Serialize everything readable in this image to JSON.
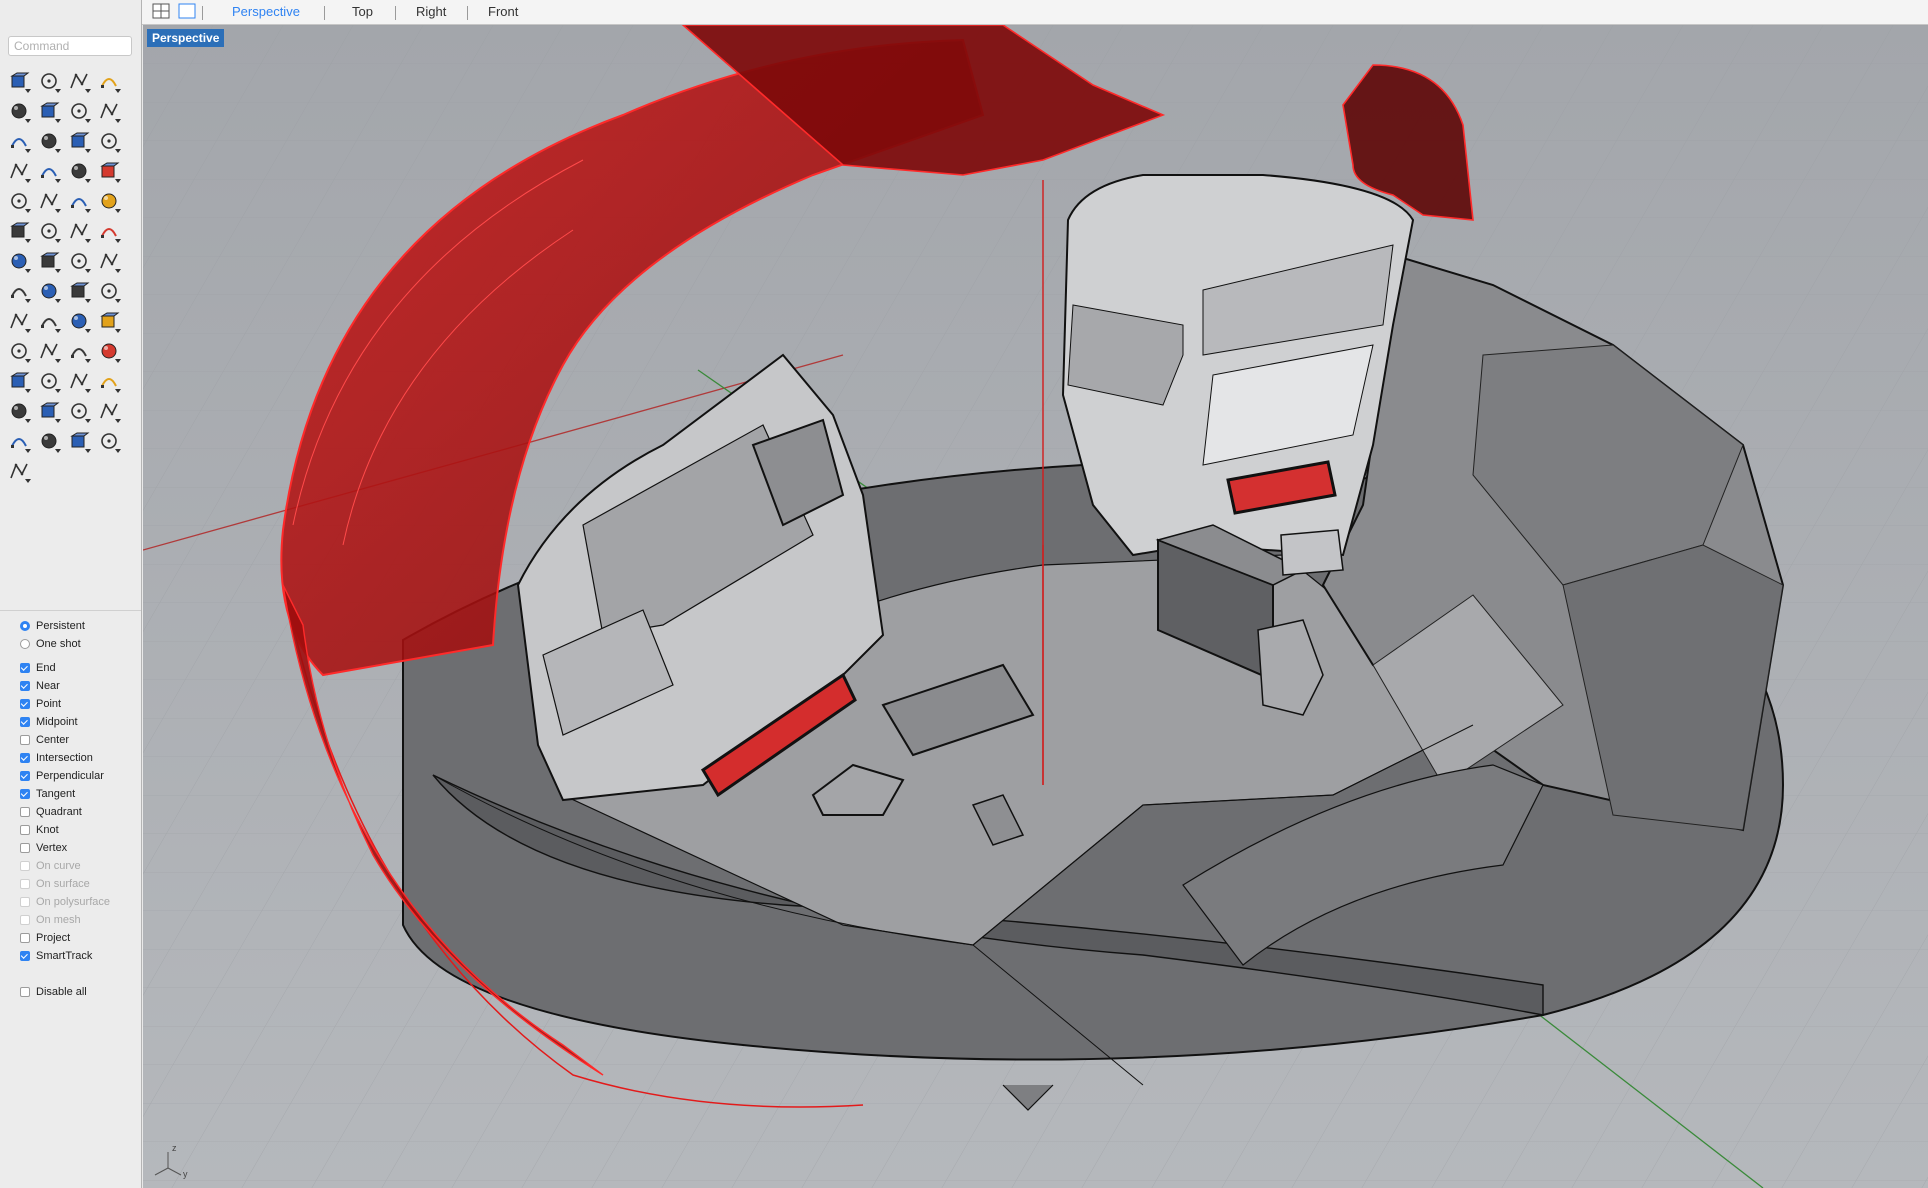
{
  "command": {
    "placeholder": "Command"
  },
  "toolbar_icons": [
    "select-arrow-icon",
    "point-icon",
    "polyline-icon",
    "curve-icon",
    "circle-icon",
    "ellipse-icon",
    "polygon-icon",
    "rectangle-icon",
    "arc-icon",
    "fillet-icon",
    "surface-patch-icon",
    "surface-edge-icon",
    "box-solid-icon",
    "sphere-solid-icon",
    "cylinder-icon",
    "plane-icon",
    "explode-icon",
    "boolean-icon",
    "extrude-icon",
    "sweep-icon",
    "group-icon",
    "join-icon",
    "offset-icon",
    "blend-icon",
    "text-icon",
    "move-icon",
    "array-icon",
    "mirror-icon",
    "block-icon",
    "dimension-icon",
    "grid-array-icon",
    "layer-icon",
    "analyze-icon",
    "check-icon",
    "shade-icon",
    "paint-icon",
    "zoom-extents-icon",
    "zoom-window-icon",
    "zoom-selected-icon",
    "zoom-icon",
    "rotate-view-icon",
    "car-render-icon",
    "material-icon",
    "render-light-icon",
    "light-bulb-icon",
    "lock-icon",
    "color-swatch-icon",
    "color-wheel-icon",
    "sphere-wire-icon",
    "sphere-mesh-icon",
    "sphere-render-icon",
    "cone-icon",
    "gumball-icon"
  ],
  "osnap": {
    "modes": [
      {
        "label": "Persistent",
        "on": true
      },
      {
        "label": "One shot",
        "on": false
      }
    ],
    "snaps": [
      {
        "label": "End",
        "checked": true,
        "enabled": true
      },
      {
        "label": "Near",
        "checked": true,
        "enabled": true
      },
      {
        "label": "Point",
        "checked": true,
        "enabled": true
      },
      {
        "label": "Midpoint",
        "checked": true,
        "enabled": true
      },
      {
        "label": "Center",
        "checked": false,
        "enabled": true
      },
      {
        "label": "Intersection",
        "checked": true,
        "enabled": true
      },
      {
        "label": "Perpendicular",
        "checked": true,
        "enabled": true
      },
      {
        "label": "Tangent",
        "checked": true,
        "enabled": true
      },
      {
        "label": "Quadrant",
        "checked": false,
        "enabled": true
      },
      {
        "label": "Knot",
        "checked": false,
        "enabled": true
      },
      {
        "label": "Vertex",
        "checked": false,
        "enabled": true
      },
      {
        "label": "On curve",
        "checked": false,
        "enabled": false
      },
      {
        "label": "On surface",
        "checked": false,
        "enabled": false
      },
      {
        "label": "On polysurface",
        "checked": false,
        "enabled": false
      },
      {
        "label": "On mesh",
        "checked": false,
        "enabled": false
      },
      {
        "label": "Project",
        "checked": false,
        "enabled": true
      },
      {
        "label": "SmartTrack",
        "checked": true,
        "enabled": true
      }
    ],
    "disable_all": {
      "label": "Disable all",
      "checked": false
    }
  },
  "viewport_tabs": [
    {
      "label": "Perspective",
      "active": true
    },
    {
      "label": "Top",
      "active": false
    },
    {
      "label": "Right",
      "active": false
    },
    {
      "label": "Front",
      "active": false
    }
  ],
  "viewport": {
    "label": "Perspective",
    "axis_labels": {
      "z": "z",
      "y": "y"
    }
  },
  "colors": {
    "accent": "#2f83f2",
    "selected_object": "#d42020",
    "viewport_background": "#a9acb1",
    "grid_x_axis": "#b03a3a",
    "grid_y_axis": "#3a8a3a"
  }
}
